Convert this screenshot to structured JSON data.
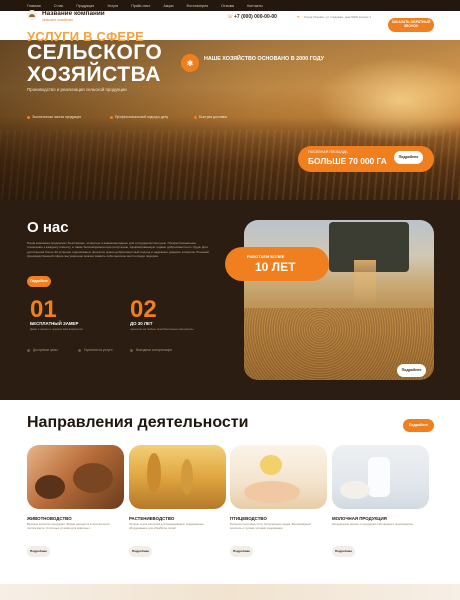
{
  "topnav": {
    "items": [
      "Главная",
      "О нас",
      "Продукция",
      "Услуги",
      "Прайс-лист",
      "Акции",
      "Фотогалерея",
      "Отзывы",
      "Контакты"
    ]
  },
  "header": {
    "company_name": "Название компании",
    "company_sub": "сельское хозяйство",
    "phone": "+7 (000) 000-00-00",
    "address": "Город Москва, ул. Садовая, дом №00 корпус 1",
    "cta": "ЗАКАЗАТЬ ОБРАТНЫЙ ЗВОНОК"
  },
  "hero": {
    "kicker": "УСЛУГИ В СФЕРЕ",
    "title_line1": "СЕЛЬСКОГО",
    "title_line2": "ХОЗЯЙСТВА",
    "subtitle": "Производство и реализация сельской продукции",
    "badge": "НАШЕ ХОЗЯЙСТВО ОСНОВАНО В 2000 ГОДУ",
    "features": [
      "Экологически чистая продукция",
      "Профессиональный подход к делу",
      "Быстрая доставка"
    ],
    "area_label": "ПОСЕВНАЯ ПЛОЩАДЬ",
    "area_value": "БОЛЬШЕ 70 000 ГА",
    "area_button": "Подробнее"
  },
  "about": {
    "title": "О нас",
    "text": "Наша компания предлагает безопасные, открытые и взаимовыгодные для сотрудничества цены. Профессиональное отношение к каждому клиенту, а также бескомпромиссную репутацию, сформированную годами добросовестного труда. Для достижения более 30 успешно подписанных проектов нужно добросовестный подход и надёжное доверие клиентов. В нашей производственной сфере мы уверенно можем заявить себе высокое место среди лидеров.",
    "button": "Подробнее",
    "stats": [
      {
        "num": "01",
        "label": "БЕСПЛАТНЫЙ ЗАМЕР",
        "sub": "Даже с наших и нужных вам вариантов"
      },
      {
        "num": "02",
        "label": "ДО 30 ЛЕТ",
        "sub": "гарантия на любые приобретённые материалы"
      }
    ],
    "bullets": [
      "Доступные цены",
      "Гарантия на услуги",
      "Выездные консультации"
    ],
    "experience_label": "РАБОТАЕМ БОЛЕЕ",
    "experience_value": "10 ЛЕТ",
    "photo_button": "Подробнее"
  },
  "directions": {
    "title": "Направления деятельности",
    "button": "Подробнее",
    "cards": [
      {
        "title": "ЖИВОТНОВОДСТВО",
        "text": "Высокое качество продукции. Ферма находится в экологически чистом месте. Отличные условия для животных.",
        "button": "Подробнее"
      },
      {
        "title": "РАСТЕНИЕВОДСТВО",
        "text": "Лучшие сорта растений для выращивания. Современное оборудование для обработки полей.",
        "button": "Подробнее"
      },
      {
        "title": "ПТИЦЕВОДСТВО",
        "text": "Большое поголовье птиц. Натуральные корма. Ветеринарный контроль и лучшие условия содержания.",
        "button": "Подробнее"
      },
      {
        "title": "МОЛОЧНАЯ ПРОДУКЦИЯ",
        "text": "Натуральное молоко и продукция собственного производства.",
        "button": "Подробнее"
      }
    ]
  },
  "colors": {
    "accent": "#f07f1f",
    "dark": "#2b1d11",
    "white": "#ffffff"
  }
}
